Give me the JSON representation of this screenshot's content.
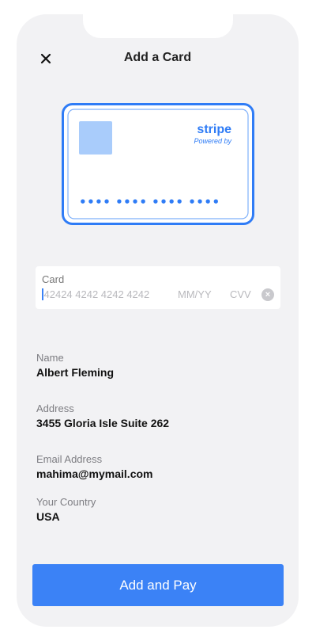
{
  "header": {
    "title": "Add a Card",
    "close_icon": "close-icon"
  },
  "card_preview": {
    "brand": "stripe",
    "tagline": "Powered by",
    "masked_number": "•••• •••• •••• ••••",
    "accent_color": "#2f7cf6",
    "chip_color": "#a9ccfb"
  },
  "card_input": {
    "label": "Card",
    "number_placeholder": "42424 4242 4242 4242",
    "expiry_placeholder": "MM/YY",
    "cvv_placeholder": "CVV",
    "clear_icon": "clear-icon"
  },
  "details": {
    "name": {
      "label": "Name",
      "value": "Albert Fleming"
    },
    "address": {
      "label": "Address",
      "value": "3455 Gloria Isle Suite 262"
    },
    "email": {
      "label": "Email Address",
      "value": "mahima@mymail.com"
    },
    "country": {
      "label": "Your Country",
      "value": "USA"
    }
  },
  "actions": {
    "submit_label": "Add and Pay",
    "button_color": "#3b82f6"
  }
}
